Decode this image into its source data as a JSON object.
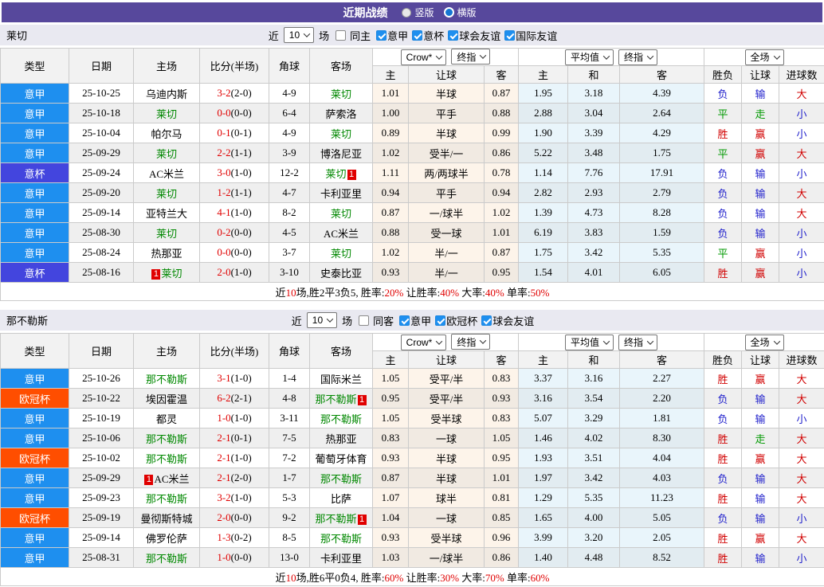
{
  "title_bar": {
    "title": "近期战绩",
    "radios": [
      {
        "label": "竖版",
        "checked": false
      },
      {
        "label": "横版",
        "checked": true
      }
    ]
  },
  "table_header": {
    "left_cols": [
      "类型",
      "日期",
      "主场",
      "比分(半场)",
      "角球",
      "客场"
    ],
    "dropdowns": {
      "crow": [
        "Crow*",
        "终指"
      ],
      "avg": [
        "平均值",
        "终指"
      ],
      "full": [
        "全场"
      ]
    },
    "sub_cols": [
      "主",
      "让球",
      "客",
      "主",
      "和",
      "客",
      "胜负",
      "让球",
      "进球数"
    ]
  },
  "league_colors": {
    "意甲": "#1E8FEF",
    "意杯": "#4345DE",
    "欧冠杯": "#FF4E00"
  },
  "sections": [
    {
      "team": "莱切",
      "filter": {
        "prefix": "近",
        "count": "10",
        "suffix": "场",
        "venue": {
          "label": "同主",
          "checked": false
        },
        "competitions": [
          {
            "label": "意甲",
            "checked": true
          },
          {
            "label": "意杯",
            "checked": true
          },
          {
            "label": "球会友谊",
            "checked": true
          },
          {
            "label": "国际友谊",
            "checked": true
          }
        ]
      },
      "rows": [
        {
          "league": "意甲",
          "date": "25-10-25",
          "home": "乌迪内斯",
          "home_card": "",
          "home_is_team": false,
          "ft": "3-2",
          "ht": "(2-0)",
          "corner": "4-9",
          "away": "莱切",
          "away_card": "",
          "away_is_team": true,
          "crow": [
            "1.01",
            "半球",
            "0.87"
          ],
          "avg": [
            "1.95",
            "3.18",
            "4.39"
          ],
          "wdl": "负",
          "wdl_c": "blue",
          "hcp": "输",
          "hcp_c": "blue",
          "ou": "大",
          "ou_c": "red"
        },
        {
          "league": "意甲",
          "date": "25-10-18",
          "home": "莱切",
          "home_card": "",
          "home_is_team": true,
          "ft": "0-0",
          "ht": "(0-0)",
          "corner": "6-4",
          "away": "萨索洛",
          "away_card": "",
          "away_is_team": false,
          "crow": [
            "1.00",
            "平手",
            "0.88"
          ],
          "avg": [
            "2.88",
            "3.04",
            "2.64"
          ],
          "wdl": "平",
          "wdl_c": "green",
          "hcp": "走",
          "hcp_c": "green",
          "ou": "小",
          "ou_c": "blue"
        },
        {
          "league": "意甲",
          "date": "25-10-04",
          "home": "帕尔马",
          "home_card": "",
          "home_is_team": false,
          "ft": "0-1",
          "ht": "(0-1)",
          "corner": "4-9",
          "away": "莱切",
          "away_card": "",
          "away_is_team": true,
          "crow": [
            "0.89",
            "半球",
            "0.99"
          ],
          "avg": [
            "1.90",
            "3.39",
            "4.29"
          ],
          "wdl": "胜",
          "wdl_c": "red",
          "hcp": "赢",
          "hcp_c": "red",
          "ou": "小",
          "ou_c": "blue"
        },
        {
          "league": "意甲",
          "date": "25-09-29",
          "home": "莱切",
          "home_card": "",
          "home_is_team": true,
          "ft": "2-2",
          "ht": "(1-1)",
          "corner": "3-9",
          "away": "博洛尼亚",
          "away_card": "",
          "away_is_team": false,
          "crow": [
            "1.02",
            "受半/一",
            "0.86"
          ],
          "avg": [
            "5.22",
            "3.48",
            "1.75"
          ],
          "wdl": "平",
          "wdl_c": "green",
          "hcp": "赢",
          "hcp_c": "red",
          "ou": "大",
          "ou_c": "red"
        },
        {
          "league": "意杯",
          "date": "25-09-24",
          "home": "AC米兰",
          "home_card": "",
          "home_is_team": false,
          "ft": "3-0",
          "ht": "(1-0)",
          "corner": "12-2",
          "away": "莱切",
          "away_card": "1",
          "away_is_team": true,
          "crow": [
            "1.11",
            "两/两球半",
            "0.78"
          ],
          "avg": [
            "1.14",
            "7.76",
            "17.91"
          ],
          "wdl": "负",
          "wdl_c": "blue",
          "hcp": "输",
          "hcp_c": "blue",
          "ou": "小",
          "ou_c": "blue"
        },
        {
          "league": "意甲",
          "date": "25-09-20",
          "home": "莱切",
          "home_card": "",
          "home_is_team": true,
          "ft": "1-2",
          "ht": "(1-1)",
          "corner": "4-7",
          "away": "卡利亚里",
          "away_card": "",
          "away_is_team": false,
          "crow": [
            "0.94",
            "平手",
            "0.94"
          ],
          "avg": [
            "2.82",
            "2.93",
            "2.79"
          ],
          "wdl": "负",
          "wdl_c": "blue",
          "hcp": "输",
          "hcp_c": "blue",
          "ou": "大",
          "ou_c": "red"
        },
        {
          "league": "意甲",
          "date": "25-09-14",
          "home": "亚特兰大",
          "home_card": "",
          "home_is_team": false,
          "ft": "4-1",
          "ht": "(1-0)",
          "corner": "8-2",
          "away": "莱切",
          "away_card": "",
          "away_is_team": true,
          "crow": [
            "0.87",
            "一/球半",
            "1.02"
          ],
          "avg": [
            "1.39",
            "4.73",
            "8.28"
          ],
          "wdl": "负",
          "wdl_c": "blue",
          "hcp": "输",
          "hcp_c": "blue",
          "ou": "大",
          "ou_c": "red"
        },
        {
          "league": "意甲",
          "date": "25-08-30",
          "home": "莱切",
          "home_card": "",
          "home_is_team": true,
          "ft": "0-2",
          "ht": "(0-0)",
          "corner": "4-5",
          "away": "AC米兰",
          "away_card": "",
          "away_is_team": false,
          "crow": [
            "0.88",
            "受一球",
            "1.01"
          ],
          "avg": [
            "6.19",
            "3.83",
            "1.59"
          ],
          "wdl": "负",
          "wdl_c": "blue",
          "hcp": "输",
          "hcp_c": "blue",
          "ou": "小",
          "ou_c": "blue"
        },
        {
          "league": "意甲",
          "date": "25-08-24",
          "home": "热那亚",
          "home_card": "",
          "home_is_team": false,
          "ft": "0-0",
          "ht": "(0-0)",
          "corner": "3-7",
          "away": "莱切",
          "away_card": "",
          "away_is_team": true,
          "crow": [
            "1.02",
            "半/一",
            "0.87"
          ],
          "avg": [
            "1.75",
            "3.42",
            "5.35"
          ],
          "wdl": "平",
          "wdl_c": "green",
          "hcp": "赢",
          "hcp_c": "red",
          "ou": "小",
          "ou_c": "blue"
        },
        {
          "league": "意杯",
          "date": "25-08-16",
          "home": "莱切",
          "home_card": "1",
          "home_is_team": true,
          "ft": "2-0",
          "ht": "(1-0)",
          "corner": "3-10",
          "away": "史泰比亚",
          "away_card": "",
          "away_is_team": false,
          "crow": [
            "0.93",
            "半/一",
            "0.95"
          ],
          "avg": [
            "1.54",
            "4.01",
            "6.05"
          ],
          "wdl": "胜",
          "wdl_c": "red",
          "hcp": "赢",
          "hcp_c": "red",
          "ou": "小",
          "ou_c": "blue"
        }
      ],
      "summary": [
        {
          "t": "近",
          "red": false
        },
        {
          "t": "10",
          "red": true
        },
        {
          "t": "场,胜2平3负5, 胜率:",
          "red": false
        },
        {
          "t": "20%",
          "red": true
        },
        {
          "t": " 让胜率:",
          "red": false
        },
        {
          "t": "40%",
          "red": true
        },
        {
          "t": " 大率:",
          "red": false
        },
        {
          "t": "40%",
          "red": true
        },
        {
          "t": " 单率:",
          "red": false
        },
        {
          "t": "50%",
          "red": true
        }
      ]
    },
    {
      "team": "那不勒斯",
      "filter": {
        "prefix": "近",
        "count": "10",
        "suffix": "场",
        "venue": {
          "label": "同客",
          "checked": false
        },
        "competitions": [
          {
            "label": "意甲",
            "checked": true
          },
          {
            "label": "欧冠杯",
            "checked": true
          },
          {
            "label": "球会友谊",
            "checked": true
          }
        ]
      },
      "rows": [
        {
          "league": "意甲",
          "date": "25-10-26",
          "home": "那不勒斯",
          "home_card": "",
          "home_is_team": true,
          "ft": "3-1",
          "ht": "(1-0)",
          "corner": "1-4",
          "away": "国际米兰",
          "away_card": "",
          "away_is_team": false,
          "crow": [
            "1.05",
            "受平/半",
            "0.83"
          ],
          "avg": [
            "3.37",
            "3.16",
            "2.27"
          ],
          "wdl": "胜",
          "wdl_c": "red",
          "hcp": "赢",
          "hcp_c": "red",
          "ou": "大",
          "ou_c": "red"
        },
        {
          "league": "欧冠杯",
          "date": "25-10-22",
          "home": "埃因霍温",
          "home_card": "",
          "home_is_team": false,
          "ft": "6-2",
          "ht": "(2-1)",
          "corner": "4-8",
          "away": "那不勒斯",
          "away_card": "1",
          "away_is_team": true,
          "crow": [
            "0.95",
            "受平/半",
            "0.93"
          ],
          "avg": [
            "3.16",
            "3.54",
            "2.20"
          ],
          "wdl": "负",
          "wdl_c": "blue",
          "hcp": "输",
          "hcp_c": "blue",
          "ou": "大",
          "ou_c": "red"
        },
        {
          "league": "意甲",
          "date": "25-10-19",
          "home": "都灵",
          "home_card": "",
          "home_is_team": false,
          "ft": "1-0",
          "ht": "(1-0)",
          "corner": "3-11",
          "away": "那不勒斯",
          "away_card": "",
          "away_is_team": true,
          "crow": [
            "1.05",
            "受半球",
            "0.83"
          ],
          "avg": [
            "5.07",
            "3.29",
            "1.81"
          ],
          "wdl": "负",
          "wdl_c": "blue",
          "hcp": "输",
          "hcp_c": "blue",
          "ou": "小",
          "ou_c": "blue"
        },
        {
          "league": "意甲",
          "date": "25-10-06",
          "home": "那不勒斯",
          "home_card": "",
          "home_is_team": true,
          "ft": "2-1",
          "ht": "(0-1)",
          "corner": "7-5",
          "away": "热那亚",
          "away_card": "",
          "away_is_team": false,
          "crow": [
            "0.83",
            "一球",
            "1.05"
          ],
          "avg": [
            "1.46",
            "4.02",
            "8.30"
          ],
          "wdl": "胜",
          "wdl_c": "red",
          "hcp": "走",
          "hcp_c": "green",
          "ou": "大",
          "ou_c": "red"
        },
        {
          "league": "欧冠杯",
          "date": "25-10-02",
          "home": "那不勒斯",
          "home_card": "",
          "home_is_team": true,
          "ft": "2-1",
          "ht": "(1-0)",
          "corner": "7-2",
          "away": "葡萄牙体育",
          "away_card": "",
          "away_is_team": false,
          "crow": [
            "0.93",
            "半球",
            "0.95"
          ],
          "avg": [
            "1.93",
            "3.51",
            "4.04"
          ],
          "wdl": "胜",
          "wdl_c": "red",
          "hcp": "赢",
          "hcp_c": "red",
          "ou": "大",
          "ou_c": "red"
        },
        {
          "league": "意甲",
          "date": "25-09-29",
          "home": "AC米兰",
          "home_card": "1",
          "home_is_team": false,
          "ft": "2-1",
          "ht": "(2-0)",
          "corner": "1-7",
          "away": "那不勒斯",
          "away_card": "",
          "away_is_team": true,
          "crow": [
            "0.87",
            "半球",
            "1.01"
          ],
          "avg": [
            "1.97",
            "3.42",
            "4.03"
          ],
          "wdl": "负",
          "wdl_c": "blue",
          "hcp": "输",
          "hcp_c": "blue",
          "ou": "大",
          "ou_c": "red"
        },
        {
          "league": "意甲",
          "date": "25-09-23",
          "home": "那不勒斯",
          "home_card": "",
          "home_is_team": true,
          "ft": "3-2",
          "ht": "(1-0)",
          "corner": "5-3",
          "away": "比萨",
          "away_card": "",
          "away_is_team": false,
          "crow": [
            "1.07",
            "球半",
            "0.81"
          ],
          "avg": [
            "1.29",
            "5.35",
            "11.23"
          ],
          "wdl": "胜",
          "wdl_c": "red",
          "hcp": "输",
          "hcp_c": "blue",
          "ou": "大",
          "ou_c": "red"
        },
        {
          "league": "欧冠杯",
          "date": "25-09-19",
          "home": "曼彻斯特城",
          "home_card": "",
          "home_is_team": false,
          "ft": "2-0",
          "ht": "(0-0)",
          "corner": "9-2",
          "away": "那不勒斯",
          "away_card": "1",
          "away_is_team": true,
          "crow": [
            "1.04",
            "一球",
            "0.85"
          ],
          "avg": [
            "1.65",
            "4.00",
            "5.05"
          ],
          "wdl": "负",
          "wdl_c": "blue",
          "hcp": "输",
          "hcp_c": "blue",
          "ou": "小",
          "ou_c": "blue"
        },
        {
          "league": "意甲",
          "date": "25-09-14",
          "home": "佛罗伦萨",
          "home_card": "",
          "home_is_team": false,
          "ft": "1-3",
          "ht": "(0-2)",
          "corner": "8-5",
          "away": "那不勒斯",
          "away_card": "",
          "away_is_team": true,
          "crow": [
            "0.93",
            "受半球",
            "0.96"
          ],
          "avg": [
            "3.99",
            "3.20",
            "2.05"
          ],
          "wdl": "胜",
          "wdl_c": "red",
          "hcp": "赢",
          "hcp_c": "red",
          "ou": "大",
          "ou_c": "red"
        },
        {
          "league": "意甲",
          "date": "25-08-31",
          "home": "那不勒斯",
          "home_card": "",
          "home_is_team": true,
          "ft": "1-0",
          "ht": "(0-0)",
          "corner": "13-0",
          "away": "卡利亚里",
          "away_card": "",
          "away_is_team": false,
          "crow": [
            "1.03",
            "一/球半",
            "0.86"
          ],
          "avg": [
            "1.40",
            "4.48",
            "8.52"
          ],
          "wdl": "胜",
          "wdl_c": "red",
          "hcp": "输",
          "hcp_c": "blue",
          "ou": "小",
          "ou_c": "blue"
        }
      ],
      "summary": [
        {
          "t": "近",
          "red": false
        },
        {
          "t": "10",
          "red": true
        },
        {
          "t": "场,胜6平0负4, 胜率:",
          "red": false
        },
        {
          "t": "60%",
          "red": true
        },
        {
          "t": " 让胜率:",
          "red": false
        },
        {
          "t": "30%",
          "red": true
        },
        {
          "t": " 大率:",
          "red": false
        },
        {
          "t": "70%",
          "red": true
        },
        {
          "t": " 单率:",
          "red": false
        },
        {
          "t": "60%",
          "red": true
        }
      ]
    }
  ]
}
